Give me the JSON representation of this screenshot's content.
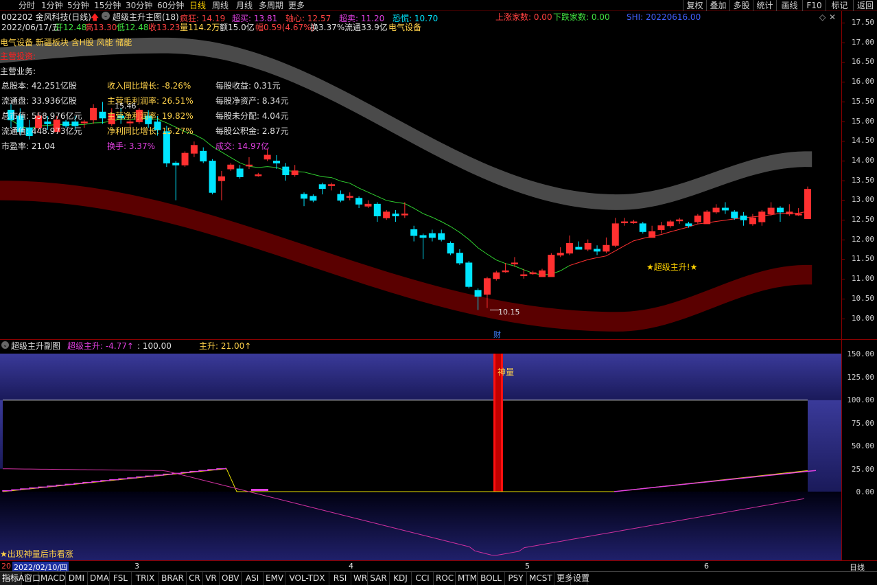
{
  "top_tabs": [
    "分时",
    "1分钟",
    "5分钟",
    "15分钟",
    "30分钟",
    "60分钟",
    "日线",
    "周线",
    "月线",
    "多周期",
    "更多"
  ],
  "active_tab": "日线",
  "legend": {
    "title": "超级主升主图(18)",
    "items": [
      {
        "label": "疯狂: 14.19",
        "color": "#ff4040"
      },
      {
        "label": "超买: 13.81",
        "color": "#e040e0"
      },
      {
        "label": "轴心: 12.57",
        "color": "#ff4040"
      },
      {
        "label": "超卖: 11.20",
        "color": "#e040e0"
      },
      {
        "label": "恐慌: 10.70",
        "color": "#00e5ff"
      }
    ]
  },
  "right_tools": [
    "复权",
    "叠加",
    "多股",
    "统计",
    "画线",
    "F10",
    "标记",
    "返回"
  ],
  "stock": {
    "code_name": "002202 金风科技(日线)",
    "market_up": "上涨家数: 0.00",
    "market_down": "下跌家数: 0.00",
    "index_label": "SHI: 20220616.00",
    "date": "2022/06/17/五",
    "open": "开12.48",
    "high": "高13.30",
    "low": "低12.48",
    "close": "收13.23",
    "volume": "量114.2万",
    "amount": "额15.0亿",
    "change": "幅0.59(4.67%)",
    "turnover": "换3.37%",
    "float": "流通33.9亿",
    "sector": "电气设备",
    "concepts": "电气设备 新疆板块 含H股 风能 储能",
    "main_business_title": "主营投资:",
    "business_label": "主营业务:"
  },
  "financials": [
    {
      "text": "总股本: 42.251亿股",
      "style": "w"
    },
    {
      "text": "收入同比增长: -8.26%",
      "style": "y"
    },
    {
      "text": "每股收益: 0.31元",
      "style": "w"
    },
    {
      "text": "流通盘: 33.936亿股",
      "style": "w"
    },
    {
      "text": "主营毛利润率: 26.51%",
      "style": "y"
    },
    {
      "text": "每股净资产: 8.34元",
      "style": "w"
    },
    {
      "text": "总市值: 558.976亿元",
      "style": "w"
    },
    {
      "text": "主营净利润率: 19.82%",
      "style": "y"
    },
    {
      "text": "每股未分配: 4.04元",
      "style": "w"
    },
    {
      "text": "流通值: 448.973亿元",
      "style": "w"
    },
    {
      "text": "净利同比增长: 15.27%",
      "style": "y"
    },
    {
      "text": "每股公积金: 2.87元",
      "style": "w"
    },
    {
      "text": "市盈率: 21.04",
      "style": "w"
    },
    {
      "text": "换手: 3.37%",
      "style": "m"
    },
    {
      "text": "成交: 14.97亿",
      "style": "m"
    }
  ],
  "price_axis": [
    "17.50",
    "17.00",
    "16.50",
    "16.00",
    "15.50",
    "15.00",
    "14.50",
    "14.00",
    "13.50",
    "13.00",
    "12.50",
    "12.00",
    "11.50",
    "11.00",
    "10.50",
    "10.00"
  ],
  "annotations": {
    "high_mark": "15.46",
    "low_mark": "10.15",
    "signal": "★超级主升!★",
    "fin_report": "财"
  },
  "sub_panel": {
    "title": "超级主升副图",
    "val1": "超级主升: -4.77↑",
    "val2": ": 100.00",
    "val3": "主升: 21.00↑",
    "axis": [
      "150.00",
      "125.00",
      "100.00",
      "75.00",
      "50.00",
      "25.00",
      "0.00"
    ],
    "shenliang": "神量",
    "note": "★出现神量后市看涨"
  },
  "time_axis": {
    "left": "20",
    "cursor_date": "2022/02/10/四",
    "months": [
      "3",
      "4",
      "5",
      "6"
    ],
    "right": "日线"
  },
  "indicators": [
    "指标A",
    "窗口",
    "MACD",
    "DMI",
    "DMA",
    "FSL",
    "TRIX",
    "BRAR",
    "CR",
    "VR",
    "OBV",
    "ASI",
    "EMV",
    "VOL-TDX",
    "RSI",
    "WR",
    "SAR",
    "KDJ",
    "CCI",
    "ROC",
    "MTM",
    "BOLL",
    "PSY",
    "MCST",
    "更多",
    "设置"
  ],
  "chart_data": {
    "type": "candlestick",
    "y_range": [
      9.6,
      17.7
    ],
    "candles": [
      [
        15.25,
        15.0,
        15.4,
        14.8
      ],
      [
        15.1,
        14.7,
        15.3,
        14.6
      ],
      [
        14.8,
        14.6,
        15.0,
        14.5
      ],
      [
        14.8,
        15.1,
        15.2,
        14.7
      ],
      [
        14.95,
        14.9,
        15.1,
        14.75
      ],
      [
        14.7,
        15.0,
        15.1,
        14.7
      ],
      [
        14.95,
        14.85,
        15.0,
        14.8
      ],
      [
        14.95,
        14.85,
        15.1,
        14.75
      ],
      [
        14.95,
        14.95,
        15.0,
        14.8
      ],
      [
        15.0,
        15.3,
        15.4,
        14.9
      ],
      [
        15.2,
        15.05,
        15.46,
        14.9
      ],
      [
        14.9,
        15.15,
        15.3,
        14.85
      ],
      [
        15.1,
        15.05,
        15.3,
        14.9
      ],
      [
        14.95,
        14.95,
        15.1,
        14.8
      ],
      [
        14.95,
        15.25,
        15.3,
        14.9
      ],
      [
        15.1,
        14.9,
        15.25,
        14.8
      ],
      [
        14.95,
        14.75,
        15.1,
        14.6
      ],
      [
        14.7,
        13.9,
        14.85,
        13.8
      ],
      [
        13.9,
        13.85,
        13.95,
        12.95
      ],
      [
        13.85,
        14.15,
        14.2,
        13.8
      ],
      [
        14.15,
        14.35,
        14.45,
        14.05
      ],
      [
        14.2,
        13.95,
        14.3,
        13.9
      ],
      [
        13.95,
        13.15,
        14.0,
        13.1
      ],
      [
        13.45,
        13.55,
        13.7,
        12.95
      ],
      [
        13.75,
        13.85,
        13.9,
        13.7
      ],
      [
        13.75,
        13.55,
        13.85,
        13.5
      ],
      [
        13.85,
        13.85,
        14.05,
        13.75
      ],
      [
        13.6,
        13.6,
        13.65,
        13.55
      ],
      [
        14.0,
        14.1,
        14.25,
        13.95
      ],
      [
        13.95,
        13.9,
        14.1,
        13.75
      ],
      [
        13.8,
        13.6,
        13.9,
        13.45
      ],
      [
        13.6,
        13.7,
        13.85,
        13.55
      ],
      [
        13.1,
        13.0,
        13.15,
        12.8
      ],
      [
        13.05,
        12.95,
        13.1,
        12.9
      ],
      [
        13.35,
        13.25,
        13.4,
        13.1
      ],
      [
        13.35,
        13.35,
        13.4,
        13.2
      ],
      [
        13.1,
        12.95,
        13.2,
        12.9
      ],
      [
        13.05,
        13.05,
        13.15,
        12.95
      ],
      [
        13.0,
        12.85,
        13.05,
        12.75
      ],
      [
        12.8,
        12.85,
        12.95,
        12.75
      ],
      [
        12.85,
        12.55,
        12.9,
        12.4
      ],
      [
        12.5,
        12.65,
        12.7,
        12.45
      ],
      [
        12.6,
        12.55,
        12.7,
        12.4
      ],
      [
        12.6,
        12.6,
        12.9,
        12.5
      ],
      [
        12.2,
        12.05,
        12.3,
        11.9
      ],
      [
        12.05,
        12.0,
        12.1,
        11.45
      ],
      [
        12.1,
        12.0,
        12.2,
        11.9
      ],
      [
        12.1,
        11.95,
        12.2,
        11.9
      ],
      [
        11.85,
        11.6,
        11.9,
        11.55
      ],
      [
        11.6,
        11.35,
        11.7,
        11.3
      ],
      [
        11.35,
        10.75,
        11.4,
        10.7
      ],
      [
        10.65,
        10.5,
        10.7,
        10.15
      ],
      [
        10.55,
        10.95,
        11.0,
        10.2
      ],
      [
        10.95,
        11.1,
        11.15,
        10.9
      ],
      [
        11.15,
        11.15,
        11.35,
        11.1
      ],
      [
        11.35,
        11.35,
        11.5,
        11.25
      ],
      [
        11.05,
        11.05,
        11.2,
        10.95
      ],
      [
        11.1,
        11.1,
        11.15,
        11.05
      ],
      [
        11.0,
        11.15,
        11.2,
        11.0
      ],
      [
        11.0,
        11.55,
        11.6,
        11.0
      ],
      [
        11.55,
        11.6,
        11.75,
        11.5
      ],
      [
        11.6,
        11.85,
        12.05,
        11.55
      ],
      [
        11.75,
        11.7,
        11.9,
        11.7
      ],
      [
        11.7,
        11.85,
        11.95,
        11.65
      ],
      [
        11.7,
        11.65,
        11.8,
        11.55
      ],
      [
        11.65,
        11.8,
        12.0,
        11.6
      ],
      [
        11.8,
        12.35,
        12.5,
        11.75
      ],
      [
        12.4,
        12.4,
        12.5,
        12.3
      ],
      [
        12.4,
        12.4,
        12.45,
        12.35
      ],
      [
        12.35,
        12.15,
        12.4,
        12.1
      ],
      [
        12.0,
        12.15,
        12.3,
        12.0
      ],
      [
        12.2,
        12.3,
        12.4,
        12.1
      ],
      [
        12.3,
        12.4,
        12.45,
        12.25
      ],
      [
        12.45,
        12.45,
        12.5,
        12.35
      ],
      [
        12.35,
        12.3,
        12.4,
        12.25
      ],
      [
        12.4,
        12.55,
        12.6,
        12.35
      ],
      [
        12.35,
        12.65,
        12.7,
        12.35
      ],
      [
        12.65,
        12.75,
        12.85,
        12.6
      ],
      [
        12.75,
        12.7,
        12.9,
        12.6
      ],
      [
        12.65,
        12.5,
        12.7,
        12.45
      ],
      [
        12.55,
        12.45,
        12.65,
        12.3
      ],
      [
        12.35,
        12.5,
        12.6,
        12.3
      ],
      [
        12.4,
        12.65,
        12.7,
        12.3
      ],
      [
        12.6,
        12.75,
        12.9,
        12.55
      ],
      [
        12.75,
        12.65,
        12.8,
        12.4
      ],
      [
        12.6,
        12.65,
        12.85,
        12.55
      ],
      [
        12.6,
        12.6,
        12.75,
        12.55
      ],
      [
        12.48,
        13.23,
        13.3,
        12.48
      ]
    ]
  }
}
